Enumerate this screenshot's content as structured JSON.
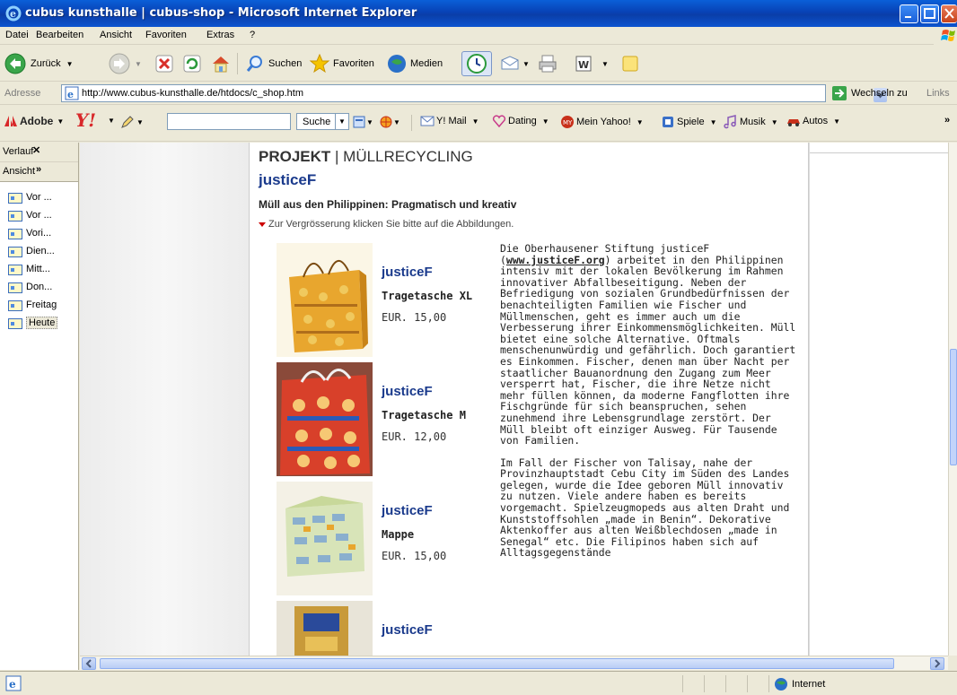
{
  "window": {
    "title": "cubus kunsthalle | cubus-shop - Microsoft Internet Explorer"
  },
  "menu": [
    "Datei",
    "Bearbeiten",
    "Ansicht",
    "Favoriten",
    "Extras",
    "?"
  ],
  "toolbar": {
    "back": "Zurück",
    "search": "Suchen",
    "favorites": "Favoriten",
    "media": "Medien"
  },
  "address": {
    "label": "Adresse",
    "url": "http://www.cubus-kunsthalle.de/htdocs/c_shop.htm",
    "go": "Wechseln zu",
    "links": "Links"
  },
  "yahoo": {
    "adobe": "Adobe",
    "search": "Suche",
    "mail": "Y! Mail",
    "dating": "Dating",
    "myyahoo": "Mein Yahoo!",
    "games": "Spiele",
    "music": "Musik",
    "autos": "Autos"
  },
  "sidebar": {
    "history": "Verlauf",
    "view": "Ansicht",
    "items": [
      "Vor ...",
      "Vor ...",
      "Vori...",
      "Dien...",
      "Mitt...",
      "Don...",
      "Freitag",
      "Heute"
    ]
  },
  "page": {
    "heading_bold": "PROJEKT",
    "heading_rest": " | MÜLLRECYCLING",
    "brand": "justiceF",
    "subtitle": "Müll aus den Philippinen: Pragmatisch und kreativ",
    "hint": "Zur Vergrösserung klicken Sie bitte auf die Abbildungen.",
    "products": [
      {
        "brand": "justiceF",
        "name": "Tragetasche XL",
        "price": "EUR. 15,00"
      },
      {
        "brand": "justiceF",
        "name": "Tragetasche M",
        "price": "EUR. 12,00"
      },
      {
        "brand": "justiceF",
        "name": "Mappe",
        "price": "EUR. 15,00"
      },
      {
        "brand": "justiceF",
        "name": "",
        "price": ""
      }
    ],
    "desc_p1_a": "Die Oberhausener Stiftung justiceF (",
    "desc_link": "www.justiceF.org",
    "desc_p1_b": ") arbeitet in den Philippinen intensiv mit der lokalen Bevölkerung im Rahmen innovativer Abfallbeseitigung. Neben der Befriedigung von sozialen Grundbedürfnissen der benachteiligten Familien wie Fischer und Müllmenschen, geht es immer auch um die Verbesserung ihrer Einkommensmöglichkeiten. Müll bietet eine solche Alternative. Oftmals menschenunwürdig und gefährlich. Doch garantiert es Einkommen. Fischer, denen man über Nacht per staatlicher Bauanordnung den Zugang zum Meer versperrt hat, Fischer, die ihre Netze nicht mehr füllen können, da moderne Fangflotten ihre Fischgründe für sich beanspruchen, sehen zunehmend ihre Lebensgrundlage zerstört. Der Müll bleibt oft einziger Ausweg. Für Tausende von Familien.",
    "desc_p2": "Im Fall der Fischer von Talisay, nahe der Provinzhauptstadt Cebu City im Süden des Landes gelegen, wurde die Idee geboren Müll innovativ zu nutzen. Viele andere haben es bereits vorgemacht. Spielzeugmopeds aus alten Draht und Kunststoffsohlen „made in Benin“. Dekorative Aktenkoffer aus alten Weißblechdosen „made in Senegal“ etc. Die Filipinos haben sich auf Alltagsgegenstände"
  },
  "status": {
    "zone": "Internet"
  },
  "colors": {
    "brand_blue": "#1a3a8c",
    "xp_title": "#0a4fd0"
  }
}
